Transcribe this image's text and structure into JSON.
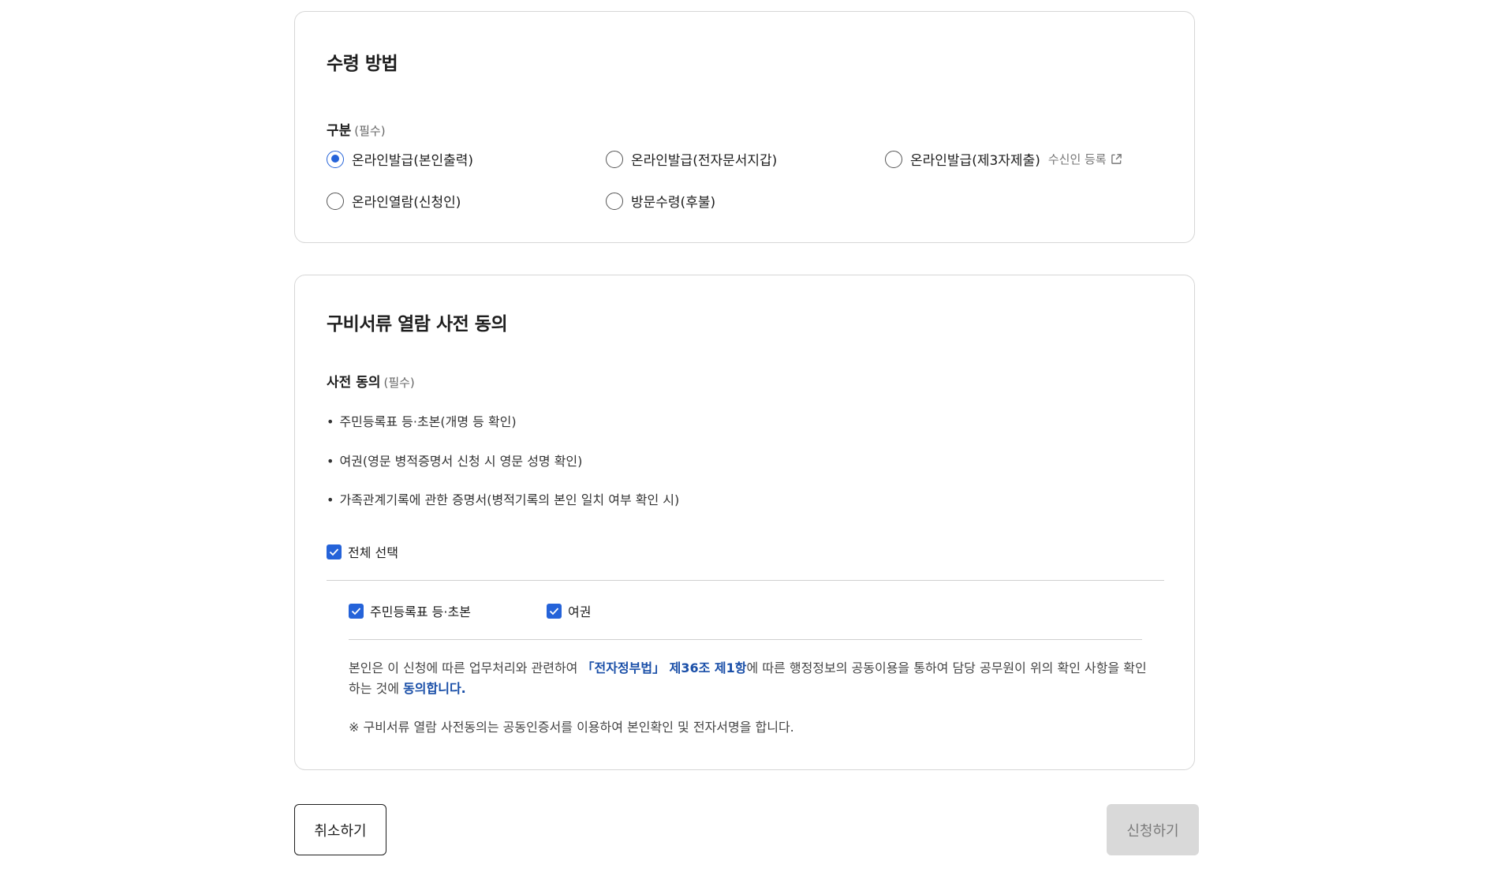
{
  "receipt": {
    "title": "수령 방법",
    "label": "구분",
    "required": "(필수)",
    "options": [
      {
        "label": "온라인발급(본인출력)",
        "checked": true
      },
      {
        "label": "온라인발급(전자문서지갑)",
        "checked": false
      },
      {
        "label": "온라인발급(제3자제출)",
        "checked": false
      },
      {
        "label": "온라인열람(신청인)",
        "checked": false
      },
      {
        "label": "방문수령(후불)",
        "checked": false
      }
    ],
    "recipient_link": "수신인 등록"
  },
  "consent": {
    "title": "구비서류 열람 사전 동의",
    "label": "사전 동의",
    "required": "(필수)",
    "bullets": [
      "주민등록표 등·초본(개명 등 확인)",
      "여권(영문 병적증명서 신청 시 영문 성명 확인)",
      "가족관계기록에 관한 증명서(병적기록의 본인 일치 여부 확인 시)"
    ],
    "select_all": "전체 선택",
    "items": [
      {
        "label": "주민등록표 등·초본",
        "checked": true
      },
      {
        "label": "여권",
        "checked": true
      }
    ],
    "notice_pre": "본인은 이 신청에 따른 업무처리와 관련하여 ",
    "notice_law": "「전자정부법」 제36조 제1항",
    "notice_mid": "에 따른 행정정보의 공동이용을 통하여 담당 공무원이 위의 확인 사항을 확인하는 것에 ",
    "notice_agree": "동의합니다.",
    "note": "※ 구비서류 열람 사전동의는 공동인증서를 이용하여 본인확인 및 전자서명을 합니다."
  },
  "buttons": {
    "cancel": "취소하기",
    "submit": "신청하기"
  },
  "colors": {
    "accent": "#2563d9",
    "link": "#1a4fa8",
    "disabled_bg": "#d9d9d9"
  }
}
